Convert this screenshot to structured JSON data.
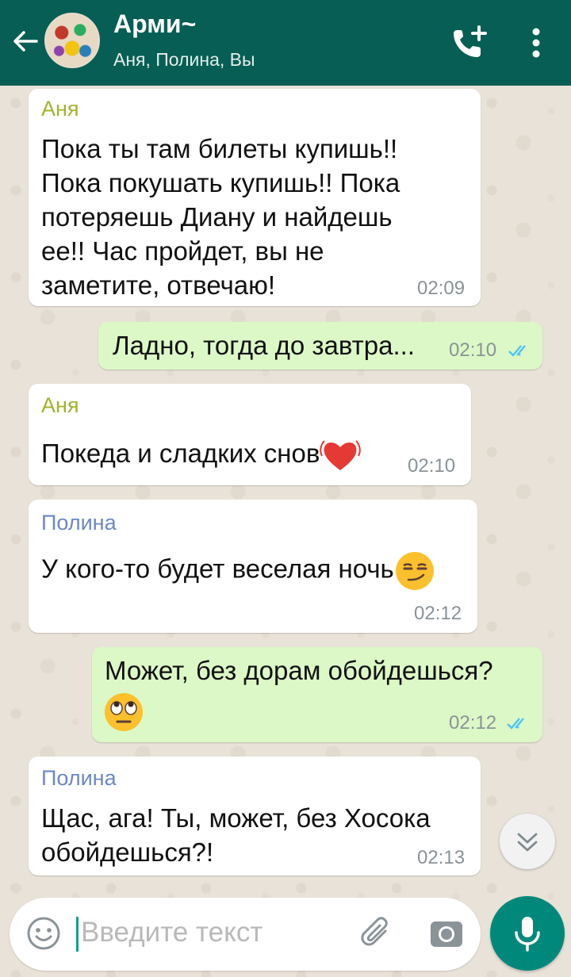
{
  "header": {
    "title": "Арми~",
    "subtitle": "Аня, Полина, Вы",
    "icons": [
      "back-arrow-icon",
      "group-avatar",
      "add-call-icon",
      "more-vert-icon"
    ]
  },
  "messages": [
    {
      "direction": "in",
      "sender": "Аня",
      "lines": [
        "Пока ты там билеты купишь!!",
        "Пока покушать купишь!! Пока",
        "потеряешь Диану и найдешь",
        "ее!! Час пройдет, вы не",
        "заметите, отвечаю!"
      ],
      "time": "02:09"
    },
    {
      "direction": "out",
      "lines": [
        "Ладно, тогда до завтра..."
      ],
      "time": "02:10",
      "status": "read"
    },
    {
      "direction": "in",
      "sender": "Аня",
      "lines": [
        "Покеда и сладких снов"
      ],
      "emoji": "beating-heart",
      "time": "02:10"
    },
    {
      "direction": "in",
      "sender": "Полина",
      "lines": [
        "У кого-то будет веселая ночь"
      ],
      "emoji": "smirking-face",
      "time": "02:12"
    },
    {
      "direction": "out",
      "lines": [
        "Может, без дорам обойдешься?"
      ],
      "emoji": "eye-roll-face",
      "time": "02:12",
      "status": "read"
    },
    {
      "direction": "in",
      "sender": "Полина",
      "lines": [
        "Щас, ага! Ты, может, без Хосока",
        "обойдешься?!"
      ],
      "time": "02:13"
    }
  ],
  "composer": {
    "placeholder": "Введите текст"
  },
  "colors": {
    "header": "#075e54",
    "incoming_bubble": "#ffffff",
    "outgoing_bubble": "#dcf8c6",
    "sender_anya": "#a4b32a",
    "sender_polina": "#6c88c4",
    "read_ticks": "#4fc3f7",
    "mic_button": "#00897b"
  }
}
